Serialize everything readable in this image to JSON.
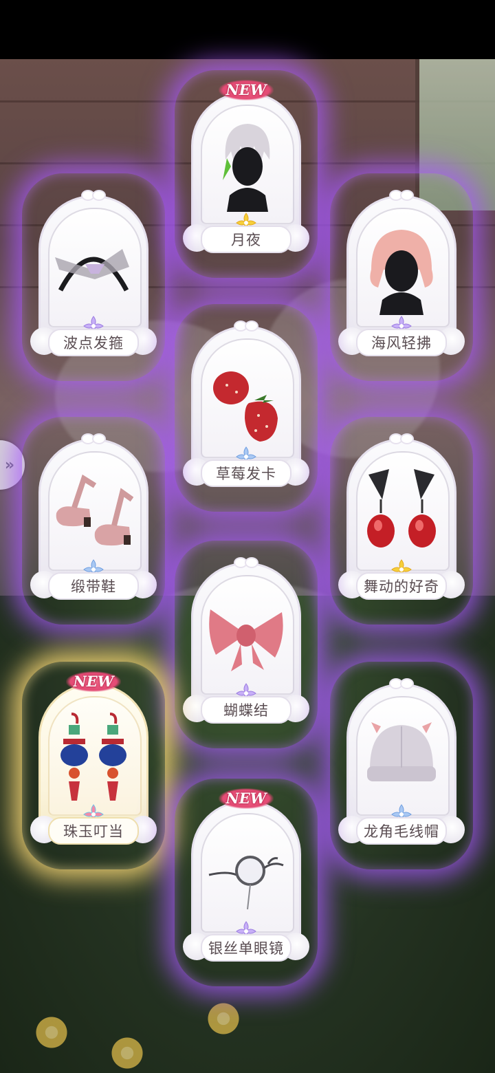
{
  "side_button": {
    "icon": "chevron-double-right-icon",
    "glyph": "»"
  },
  "new_badge": "NEW",
  "cards": [
    {
      "id": "yueye",
      "label": "月夜",
      "is_new": true,
      "frame": "purple",
      "rarity": "gold",
      "icon": "hair-silver-icon"
    },
    {
      "id": "bodian",
      "label": "波点发箍",
      "is_new": false,
      "frame": "purple",
      "rarity": "purple",
      "icon": "headband-icon"
    },
    {
      "id": "haifeng",
      "label": "海风轻拂",
      "is_new": false,
      "frame": "purple",
      "rarity": "purple",
      "icon": "hair-pink-icon"
    },
    {
      "id": "caomei",
      "label": "草莓发卡",
      "is_new": false,
      "frame": "purple",
      "rarity": "blue",
      "icon": "strawberry-hairpin-icon"
    },
    {
      "id": "duandai",
      "label": "缎带鞋",
      "is_new": false,
      "frame": "purple",
      "rarity": "blue",
      "icon": "ribbon-shoes-icon"
    },
    {
      "id": "wudong",
      "label": "舞动的好奇",
      "is_new": false,
      "frame": "purple",
      "rarity": "gold",
      "icon": "red-earrings-icon"
    },
    {
      "id": "hudiejie",
      "label": "蝴蝶结",
      "is_new": false,
      "frame": "purple",
      "rarity": "purple",
      "icon": "pink-bow-icon"
    },
    {
      "id": "zhuyu",
      "label": "珠玉叮当",
      "is_new": true,
      "frame": "gold",
      "rarity": "rainbow",
      "icon": "lantern-earrings-icon"
    },
    {
      "id": "longjiao",
      "label": "龙角毛线帽",
      "is_new": false,
      "frame": "purple",
      "rarity": "blue",
      "icon": "knit-hat-icon"
    },
    {
      "id": "yinsi",
      "label": "银丝单眼镜",
      "is_new": true,
      "frame": "purple",
      "rarity": "purple",
      "icon": "monocle-icon"
    }
  ],
  "colors": {
    "purple_glow": "#aa5aff",
    "gold_glow": "#ffdc78",
    "rarity_gold": "#f6cf3a",
    "rarity_purple": "#b79af2",
    "rarity_blue": "#8eb6ee",
    "new_badge": "#e34a74"
  }
}
